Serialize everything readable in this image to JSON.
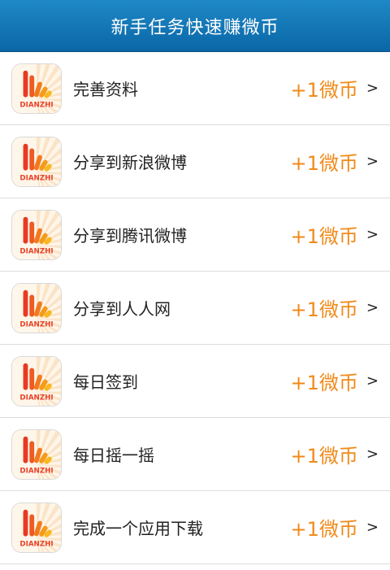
{
  "header": {
    "title": "新手任务快速赚微币"
  },
  "app_icon": {
    "logo_text": "DIANZHI",
    "icon": "dianzhi-logo-icon"
  },
  "colors": {
    "header_bg": "#0a67a7",
    "reward": "#f08a1a"
  },
  "tasks": [
    {
      "label": "完善资料",
      "reward": "+1微币",
      "chevron": ">"
    },
    {
      "label": "分享到新浪微博",
      "reward": "+1微币",
      "chevron": ">"
    },
    {
      "label": "分享到腾讯微博",
      "reward": "+1微币",
      "chevron": ">"
    },
    {
      "label": "分享到人人网",
      "reward": "+1微币",
      "chevron": ">"
    },
    {
      "label": "每日签到",
      "reward": "+1微币",
      "chevron": ">"
    },
    {
      "label": "每日摇一摇",
      "reward": "+1微币",
      "chevron": ">"
    },
    {
      "label": "完成一个应用下载",
      "reward": "+1微币",
      "chevron": ">"
    }
  ]
}
